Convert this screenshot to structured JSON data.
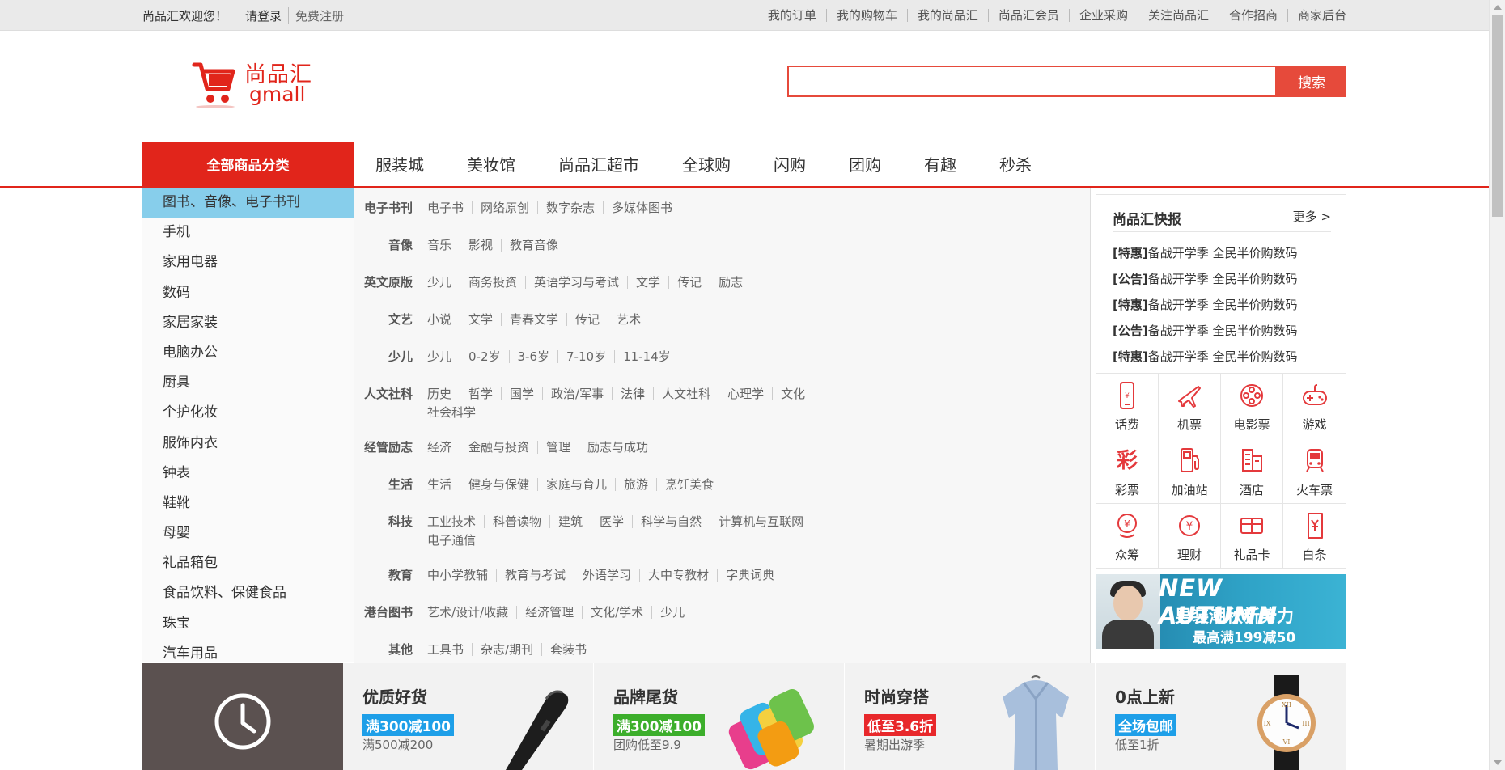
{
  "topbar": {
    "welcome": "尚品汇欢迎您！",
    "login": "请登录",
    "register": "免费注册",
    "links": [
      "我的订单",
      "我的购物车",
      "我的尚品汇",
      "尚品汇会员",
      "企业采购",
      "关注尚品汇",
      "合作招商",
      "商家后台"
    ]
  },
  "logo": {
    "cn": "尚品汇",
    "en": "gmall"
  },
  "search": {
    "value": "",
    "button": "搜索"
  },
  "nav": {
    "all": "全部商品分类",
    "items": [
      "服装城",
      "美妆馆",
      "尚品汇超市",
      "全球购",
      "闪购",
      "团购",
      "有趣",
      "秒杀"
    ]
  },
  "categories": [
    "图书、音像、电子书刊",
    "手机",
    "家用电器",
    "数码",
    "家居家装",
    "电脑办公",
    "厨具",
    "个护化妆",
    "服饰内衣",
    "钟表",
    "鞋靴",
    "母婴",
    "礼品箱包",
    "食品饮料、保健食品",
    "珠宝",
    "汽车用品"
  ],
  "subcategories": [
    {
      "title": "电子书刊",
      "links": [
        "电子书",
        "网络原创",
        "数字杂志",
        "多媒体图书"
      ]
    },
    {
      "title": "音像",
      "links": [
        "音乐",
        "影视",
        "教育音像"
      ]
    },
    {
      "title": "英文原版",
      "links": [
        "少儿",
        "商务投资",
        "英语学习与考试",
        "文学",
        "传记",
        "励志"
      ]
    },
    {
      "title": "文艺",
      "links": [
        "小说",
        "文学",
        "青春文学",
        "传记",
        "艺术"
      ]
    },
    {
      "title": "少儿",
      "links": [
        "少儿",
        "0-2岁",
        "3-6岁",
        "7-10岁",
        "11-14岁"
      ]
    },
    {
      "title": "人文社科",
      "links": [
        "历史",
        "哲学",
        "国学",
        "政治/军事",
        "法律",
        "人文社科",
        "心理学",
        "文化",
        "社会科学"
      ]
    },
    {
      "title": "经管励志",
      "links": [
        "经济",
        "金融与投资",
        "管理",
        "励志与成功"
      ]
    },
    {
      "title": "生活",
      "links": [
        "生活",
        "健身与保健",
        "家庭与育儿",
        "旅游",
        "烹饪美食"
      ]
    },
    {
      "title": "科技",
      "links": [
        "工业技术",
        "科普读物",
        "建筑",
        "医学",
        "科学与自然",
        "计算机与互联网",
        "电子通信"
      ]
    },
    {
      "title": "教育",
      "links": [
        "中小学教辅",
        "教育与考试",
        "外语学习",
        "大中专教材",
        "字典词典"
      ]
    },
    {
      "title": "港台图书",
      "links": [
        "艺术/设计/收藏",
        "经济管理",
        "文化/学术",
        "少儿"
      ]
    },
    {
      "title": "其他",
      "links": [
        "工具书",
        "杂志/期刊",
        "套装书"
      ]
    }
  ],
  "news": {
    "title": "尚品汇快报",
    "more": "更多 >",
    "items": [
      {
        "tag": "[特惠]",
        "text": "备战开学季 全民半价购数码"
      },
      {
        "tag": "[公告]",
        "text": "备战开学季 全民半价购数码"
      },
      {
        "tag": "[特惠]",
        "text": "备战开学季 全民半价购数码"
      },
      {
        "tag": "[公告]",
        "text": "备战开学季 全民半价购数码"
      },
      {
        "tag": "[特惠]",
        "text": "备战开学季 全民半价购数码"
      }
    ]
  },
  "services": [
    {
      "label": "话费",
      "icon": "phone-icon"
    },
    {
      "label": "机票",
      "icon": "plane-icon"
    },
    {
      "label": "电影票",
      "icon": "film-icon"
    },
    {
      "label": "游戏",
      "icon": "gamepad-icon"
    },
    {
      "label": "彩票",
      "icon": "lottery-icon"
    },
    {
      "label": "加油站",
      "icon": "gas-station-icon"
    },
    {
      "label": "酒店",
      "icon": "hotel-icon"
    },
    {
      "label": "火车票",
      "icon": "train-icon"
    },
    {
      "label": "众筹",
      "icon": "crowdfunding-icon"
    },
    {
      "label": "理财",
      "icon": "finance-icon"
    },
    {
      "label": "礼品卡",
      "icon": "gift-card-icon"
    },
    {
      "label": "白条",
      "icon": "credit-icon"
    }
  ],
  "banner": {
    "en": "NEW AUTUMN",
    "cn": "男装潮秋新势力",
    "sub": "最高满199减50"
  },
  "deals": [
    {
      "title": "优质好货",
      "tag": "满300减100",
      "sub": "满500减200",
      "tagColor": "#1e9fe8"
    },
    {
      "title": "品牌尾货",
      "tag": "满300减100",
      "sub": "团购低至9.9",
      "tagColor": "#3cae2b"
    },
    {
      "title": "时尚穿搭",
      "tag": "低至3.6折",
      "sub": "暑期出游季",
      "tagColor": "#e8282b"
    },
    {
      "title": "0点上新",
      "tag": "全场包邮",
      "sub": "低至1折",
      "tagColor": "#1e9fe8"
    }
  ],
  "colors": {
    "brand": "#e1251b",
    "searchAccent": "#e64a3b",
    "activeCategory": "#87ceeb"
  }
}
